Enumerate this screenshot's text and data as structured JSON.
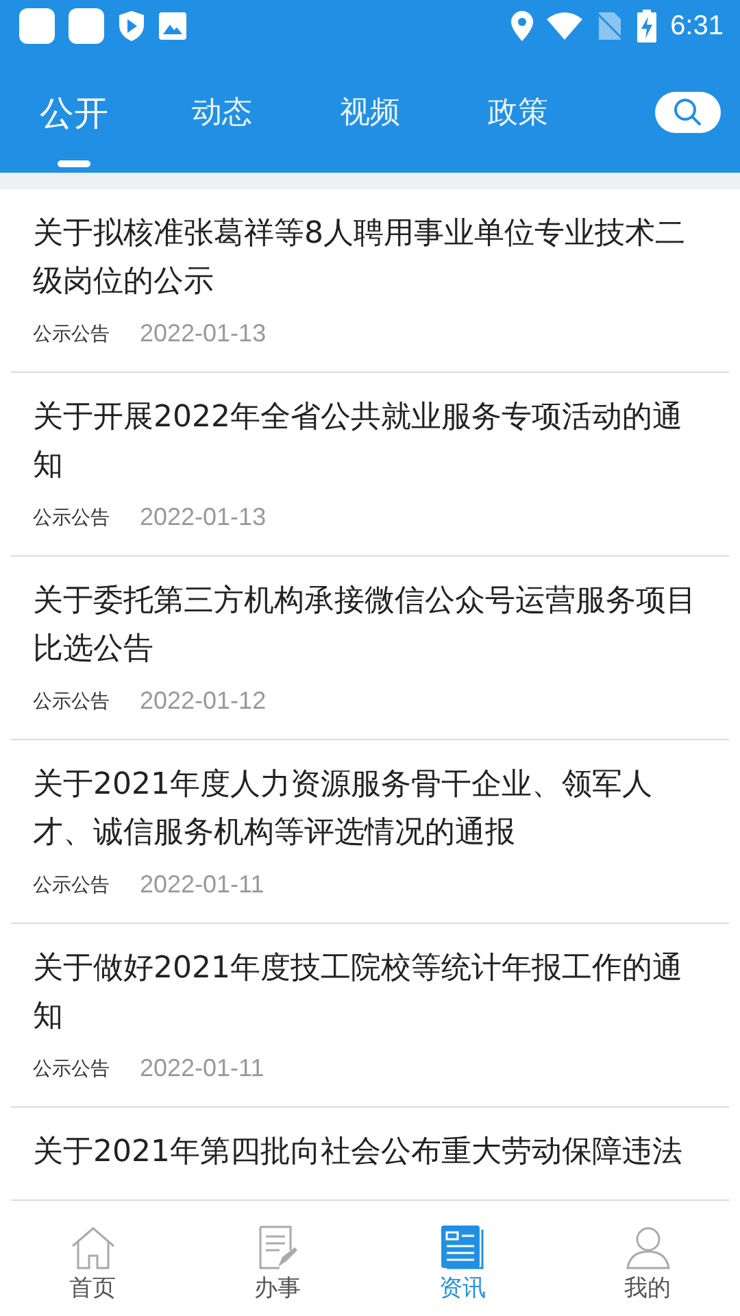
{
  "status_bar": {
    "time": "6:31"
  },
  "tabs": [
    {
      "label": "公开",
      "selected": true
    },
    {
      "label": "动态",
      "selected": false
    },
    {
      "label": "视频",
      "selected": false
    },
    {
      "label": "政策",
      "selected": false
    }
  ],
  "articles": [
    {
      "title": "关于拟核准张葛祥等8人聘用事业单位专业技术二级岗位的公示",
      "category": "公示公告",
      "date": "2022-01-13"
    },
    {
      "title": "关于开展2022年全省公共就业服务专项活动的通知",
      "category": "公示公告",
      "date": "2022-01-13"
    },
    {
      "title": "关于委托第三方机构承接微信公众号运营服务项目比选公告",
      "category": "公示公告",
      "date": "2022-01-12"
    },
    {
      "title": "关于2021年度人力资源服务骨干企业、领军人才、诚信服务机构等评选情况的通报",
      "category": "公示公告",
      "date": "2022-01-11"
    },
    {
      "title": "关于做好2021年度技工院校等统计年报工作的通知",
      "category": "公示公告",
      "date": "2022-01-11"
    },
    {
      "title": "关于2021年第四批向社会公布重大劳动保障违法"
    }
  ],
  "bottom_nav": [
    {
      "label": "首页",
      "kind": "home",
      "selected": false
    },
    {
      "label": "办事",
      "kind": "tasks",
      "selected": false
    },
    {
      "label": "资讯",
      "kind": "news",
      "selected": true
    },
    {
      "label": "我的",
      "kind": "profile",
      "selected": false
    }
  ]
}
